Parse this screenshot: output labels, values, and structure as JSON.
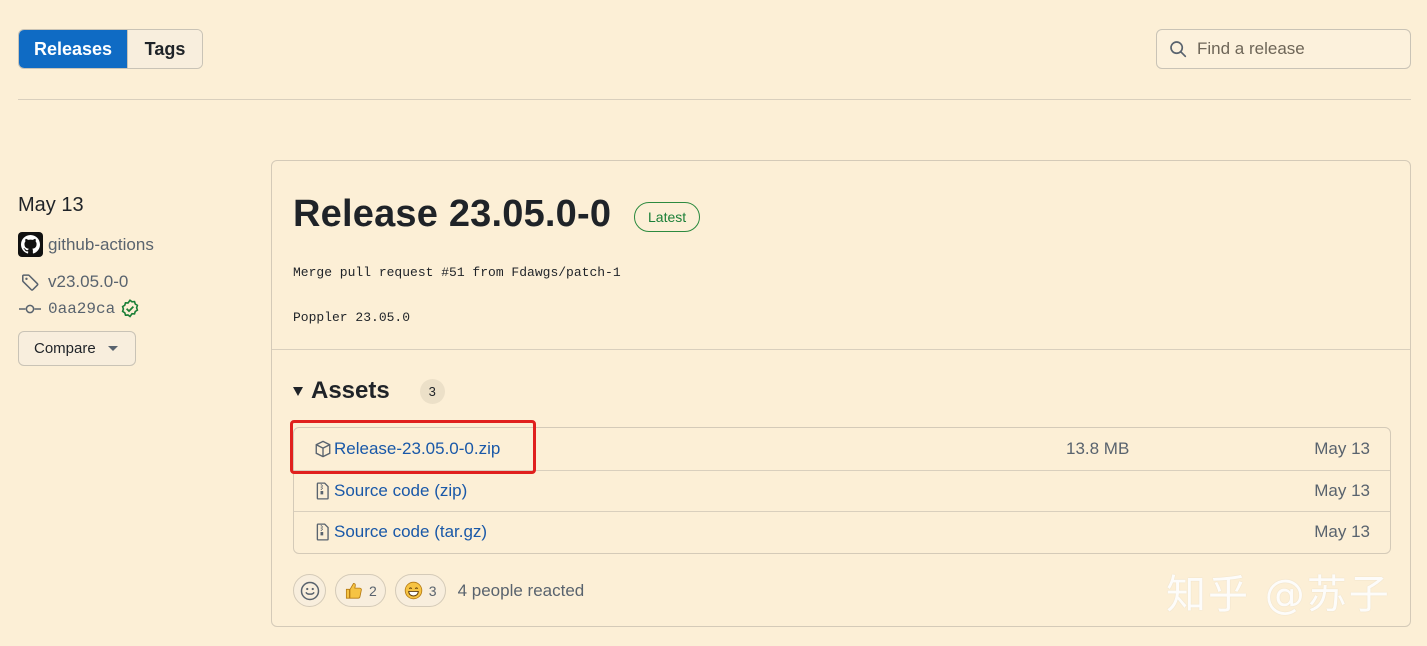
{
  "tabs": [
    {
      "label": "Releases",
      "active": true
    },
    {
      "label": "Tags",
      "active": false
    }
  ],
  "search": {
    "placeholder": "Find a release"
  },
  "meta": {
    "date": "May 13",
    "author": "github-actions",
    "tag": "v23.05.0-0",
    "commit": "0aa29ca",
    "compare_label": "Compare"
  },
  "release": {
    "title": "Release 23.05.0-0",
    "badge": "Latest",
    "body": [
      "Merge pull request #51 from Fdawgs/patch-1",
      "Poppler 23.05.0"
    ]
  },
  "assets": {
    "label": "Assets",
    "count": "3",
    "items": [
      {
        "name": "Release-23.05.0-0.zip",
        "ext": "",
        "size": "13.8 MB",
        "date": "May 13",
        "icon": "package-icon"
      },
      {
        "name": "Source code",
        "ext": "(zip)",
        "size": "",
        "date": "May 13",
        "icon": "file-zip-icon"
      },
      {
        "name": "Source code",
        "ext": "(tar.gz)",
        "size": "",
        "date": "May 13",
        "icon": "file-zip-icon"
      }
    ]
  },
  "reactions": {
    "thumbs_up": "2",
    "grin": "3",
    "summary": "4 people reacted"
  },
  "watermark": "知乎 @苏子",
  "colors": {
    "background": "#fcefd6",
    "accent": "#0f6bc4",
    "link": "#1958a8",
    "latest_badge": "#1a7f37",
    "highlight": "#e0201e"
  }
}
